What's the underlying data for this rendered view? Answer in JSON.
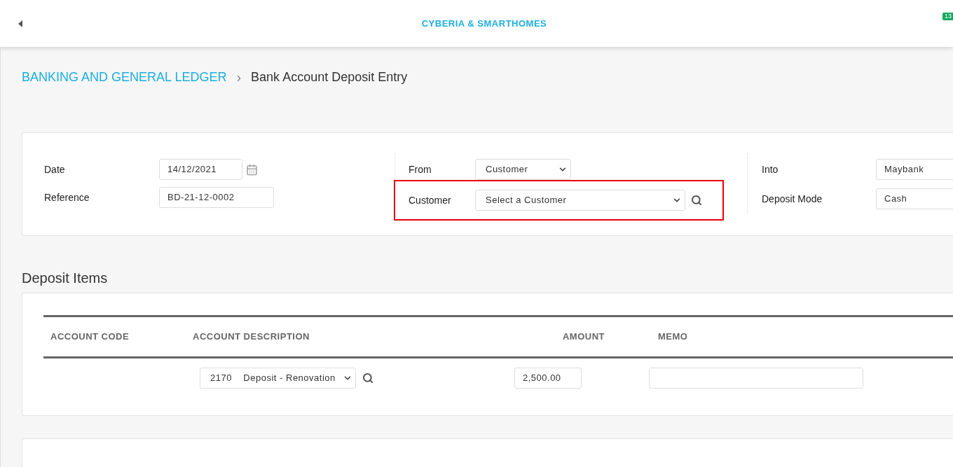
{
  "header": {
    "title": "CYBERIA & SMARTHOMES",
    "badge": "13"
  },
  "breadcrumb": {
    "parent": "BANKING AND GENERAL LEDGER",
    "separator": "›",
    "current": "Bank Account Deposit Entry"
  },
  "form": {
    "date": {
      "label": "Date",
      "value": "14/12/2021"
    },
    "reference": {
      "label": "Reference",
      "value": "BD-21-12-0002"
    },
    "from": {
      "label": "From",
      "value": "Customer"
    },
    "customer": {
      "label": "Customer",
      "value": "Select a Customer",
      "highlighted": true
    },
    "into": {
      "label": "Into",
      "value": "Maybank"
    },
    "deposit_mode": {
      "label": "Deposit Mode",
      "value": "Cash"
    }
  },
  "deposit_items": {
    "title": "Deposit Items",
    "columns": [
      "ACCOUNT CODE",
      "ACCOUNT DESCRIPTION",
      "AMOUNT",
      "MEMO"
    ],
    "rows": [
      {
        "account_description": "2170    Deposit - Renovation",
        "amount": "2,500.00"
      }
    ]
  }
}
